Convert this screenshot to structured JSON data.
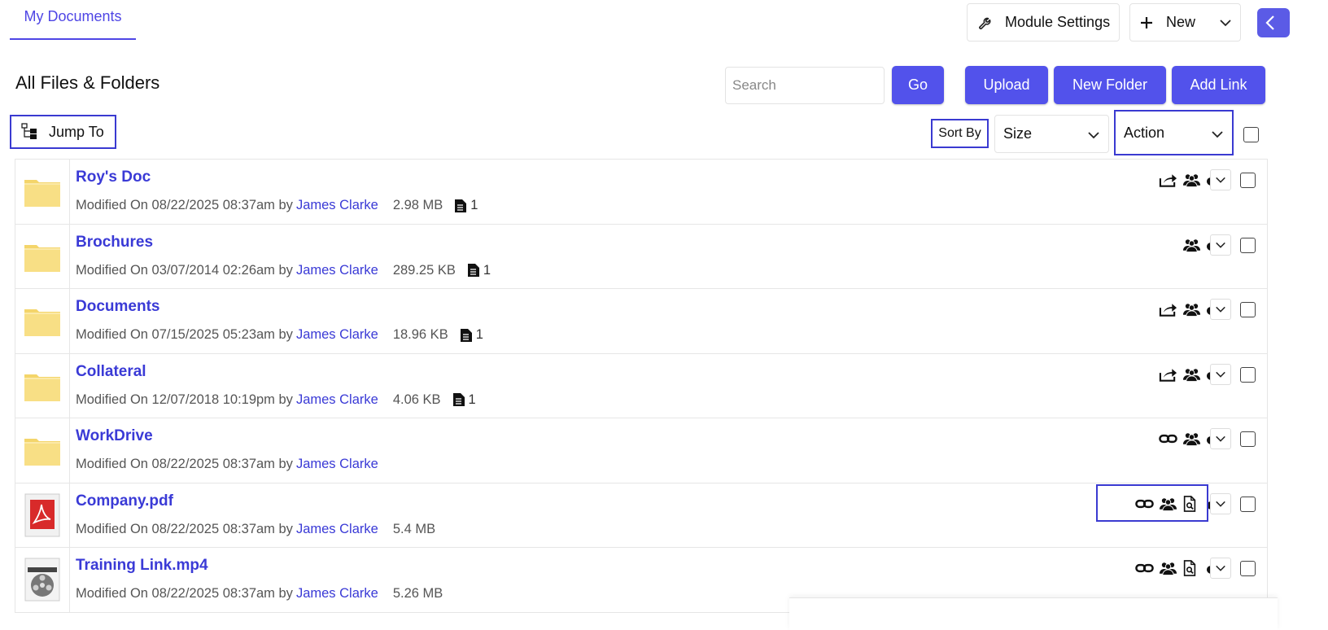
{
  "tabs": {
    "my_documents": "My Documents"
  },
  "top_actions": {
    "module_settings": "Module Settings",
    "new": "New"
  },
  "header": {
    "title": "All Files & Folders",
    "search_placeholder": "Search",
    "go": "Go",
    "upload": "Upload",
    "new_folder": "New Folder",
    "add_link": "Add Link"
  },
  "toolbar": {
    "jump_to": "Jump To",
    "sort_by": "Sort By",
    "sort_value": "Size",
    "action_value": "Action"
  },
  "colors": {
    "accent": "#5252eb",
    "link": "#3a3ad6",
    "highlight": "#3a3ad1",
    "folder": "#f7dc7a"
  },
  "files": [
    {
      "name": "Roy's Doc",
      "type": "folder",
      "modified": "Modified On 08/22/2025 08:37am by",
      "owner": "James Clarke",
      "size": "2.98 MB",
      "count": "1",
      "icons": [
        "share-icon",
        "users-icon",
        "cloud-download-icon"
      ]
    },
    {
      "name": "Brochures",
      "type": "folder",
      "modified": "Modified On 03/07/2014 02:26am by",
      "owner": "James Clarke",
      "size": "289.25 KB",
      "count": "1",
      "icons": [
        "users-icon",
        "cloud-download-icon"
      ]
    },
    {
      "name": "Documents",
      "type": "folder",
      "modified": "Modified On 07/15/2025 05:23am by",
      "owner": "James Clarke",
      "size": "18.96 KB",
      "count": "1",
      "icons": [
        "share-icon",
        "users-icon",
        "cloud-download-icon"
      ]
    },
    {
      "name": "Collateral",
      "type": "folder",
      "modified": "Modified On 12/07/2018 10:19pm by",
      "owner": "James Clarke",
      "size": "4.06 KB",
      "count": "1",
      "icons": [
        "share-icon",
        "users-icon",
        "cloud-download-icon"
      ]
    },
    {
      "name": "WorkDrive",
      "type": "folder",
      "modified": "Modified On 08/22/2025 08:37am by",
      "owner": "James Clarke",
      "size": "",
      "count": "",
      "icons": [
        "link-icon",
        "users-icon",
        "cloud-download-icon"
      ]
    },
    {
      "name": "Company.pdf",
      "type": "pdf",
      "modified": "Modified On 08/22/2025 08:37am by",
      "owner": "James Clarke",
      "size": "5.4 MB",
      "count": "",
      "icons": [
        "link-icon",
        "users-icon",
        "preview-icon",
        "cloud-download-icon"
      ]
    },
    {
      "name": "Training Link.mp4",
      "type": "video",
      "modified": "Modified On 08/22/2025 08:37am by",
      "owner": "James Clarke",
      "size": "5.26 MB",
      "count": "",
      "icons": [
        "link-icon",
        "users-icon",
        "preview-icon",
        "cloud-download-icon"
      ]
    }
  ]
}
